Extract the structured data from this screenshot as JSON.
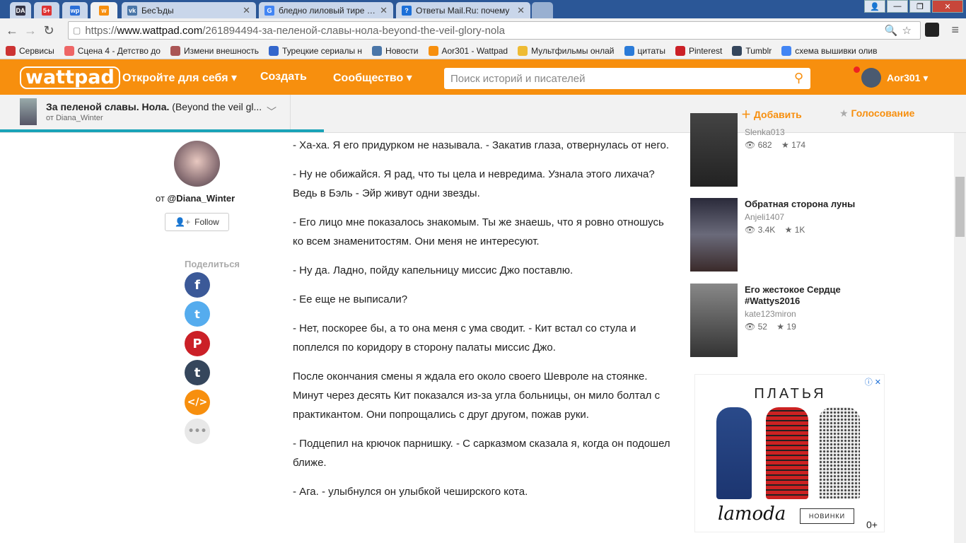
{
  "browser": {
    "tabs": [
      {
        "favicon": "DA",
        "title": ""
      },
      {
        "favicon": "5+",
        "title": ""
      },
      {
        "favicon": "wp",
        "title": ""
      },
      {
        "favicon": "w",
        "title": ""
      },
      {
        "favicon": "vk",
        "title": "БесЪды"
      },
      {
        "favicon": "G",
        "title": "бледно лиловый тире - G"
      },
      {
        "favicon": "?",
        "title": "Ответы Mail.Ru: почему"
      }
    ],
    "url_prefix": "https://",
    "url_domain": "www.wattpad.com",
    "url_path": "/261894494-за-пеленой-славы-нола-beyond-the-veil-glory-nola",
    "bookmarks": [
      {
        "label": "Сервисы",
        "color": "#c33"
      },
      {
        "label": "Сцена 4 - Детство до",
        "color": "#e66"
      },
      {
        "label": "Измени внешность",
        "color": "#a55"
      },
      {
        "label": "Турецкие сериалы н",
        "color": "#36c"
      },
      {
        "label": "Новости",
        "color": "#4a76a8"
      },
      {
        "label": "Aor301 - Wattpad",
        "color": "#f78f0e"
      },
      {
        "label": "Мультфильмы онлай",
        "color": "#eb3"
      },
      {
        "label": "цитаты",
        "color": "#2b7bd8"
      },
      {
        "label": "Pinterest",
        "color": "#cb2027"
      },
      {
        "label": "Tumblr",
        "color": "#35465c"
      },
      {
        "label": "схема вышивки олив",
        "color": "#4285f4"
      }
    ]
  },
  "header": {
    "logo": "wattpad",
    "nav": [
      "Откройте для себя",
      "Создать",
      "Сообщество"
    ],
    "search_placeholder": "Поиск историй и писателей",
    "username": "Aor301",
    "brand_color": "#f78f0e"
  },
  "storybar": {
    "title": "За пеленой славы. Нола.",
    "subtitle": "(Beyond the veil gl...",
    "author": "от Diana_Winter",
    "add_label": "Добавить",
    "vote_label": "Голосование",
    "progress": 0.335
  },
  "author": {
    "prefix": "от",
    "handle": "@Diana_Winter",
    "follow_label": "Follow"
  },
  "share": {
    "label": "Поделиться",
    "icons": [
      "facebook-icon",
      "twitter-icon",
      "pinterest-icon",
      "tumblr-icon",
      "embed-icon",
      "more-icon"
    ]
  },
  "paragraphs": [
    "- Ха-ха. Я его придурком не называла. - Закатив глаза, отвернулась от него.",
    "- Ну не обижайся. Я рад, что ты цела и невредима. Узнала этого лихача? Ведь в Бэль - Эйр живут одни звезды.",
    "- Его лицо мне показалось знакомым. Ты же знаешь, что я ровно отношусь ко всем знаменитостям. Они меня не интересуют.",
    "- Ну да. Ладно, пойду капельницу миссис Джо поставлю.",
    "- Ее еще не выписали?",
    "- Нет, поскорее бы, а то она меня с ума сводит. - Кит встал со стула и поплелся по коридору в сторону палаты миссис Джо.",
    "После окончания смены я ждала его около своего Шевроле на стоянке. Минут через десять Кит показался из-за угла больницы, он мило болтал с практикантом. Они попрощались с друг другом, пожав руки.",
    "- Подцепил на крючок парнишку. - С сарказмом сказала я, когда он подошел ближе.",
    "- Ага. - улыбнулся он улыбкой чеширского кота."
  ],
  "recommendations": [
    {
      "title": "",
      "author": "Slenka013",
      "views": "682",
      "votes": "174"
    },
    {
      "title": "Обратная сторона луны",
      "author": "Anjeli1407",
      "views": "3.4K",
      "votes": "1K"
    },
    {
      "title": "Его жестокое Сердце",
      "title2": "#Wattys2016",
      "author": "kate123miron",
      "views": "52",
      "votes": "19"
    }
  ],
  "ad": {
    "title": "ПЛАТЬЯ",
    "brand": "lamoda",
    "button": "НОВИНКИ",
    "age": "0+"
  }
}
